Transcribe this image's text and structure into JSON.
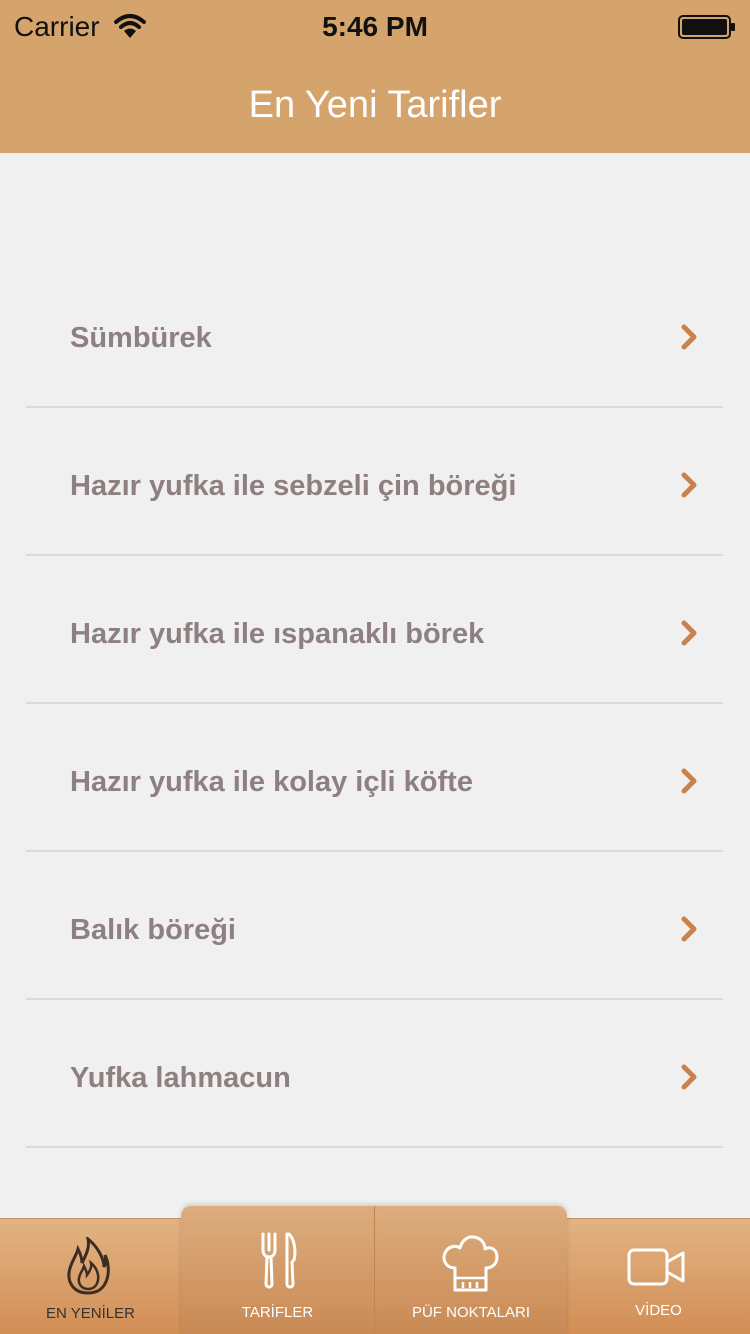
{
  "status_bar": {
    "carrier": "Carrier",
    "time": "5:46 PM"
  },
  "nav": {
    "title": "En Yeni Tarifler"
  },
  "recipes": [
    {
      "label": "Sümbürek"
    },
    {
      "label": "Hazır yufka ile sebzeli çin böreği"
    },
    {
      "label": "Hazır yufka ile ıspanaklı börek"
    },
    {
      "label": "Hazır yufka ile kolay içli köfte"
    },
    {
      "label": "Balık böreği"
    },
    {
      "label": "Yufka lahmacun"
    }
  ],
  "tabs": [
    {
      "label": "EN YENİLER",
      "icon": "flame-icon",
      "active": true
    },
    {
      "label": "TARİFLER",
      "icon": "fork-knife-icon",
      "active": false
    },
    {
      "label": "PÜF NOKTALARI",
      "icon": "chef-hat-icon",
      "active": false
    },
    {
      "label": "VİDEO",
      "icon": "video-camera-icon",
      "active": false
    }
  ],
  "colors": {
    "header": "#d4a46c",
    "accent": "#c9824c",
    "row_text": "#8e8080",
    "background": "#f0f0f0"
  }
}
